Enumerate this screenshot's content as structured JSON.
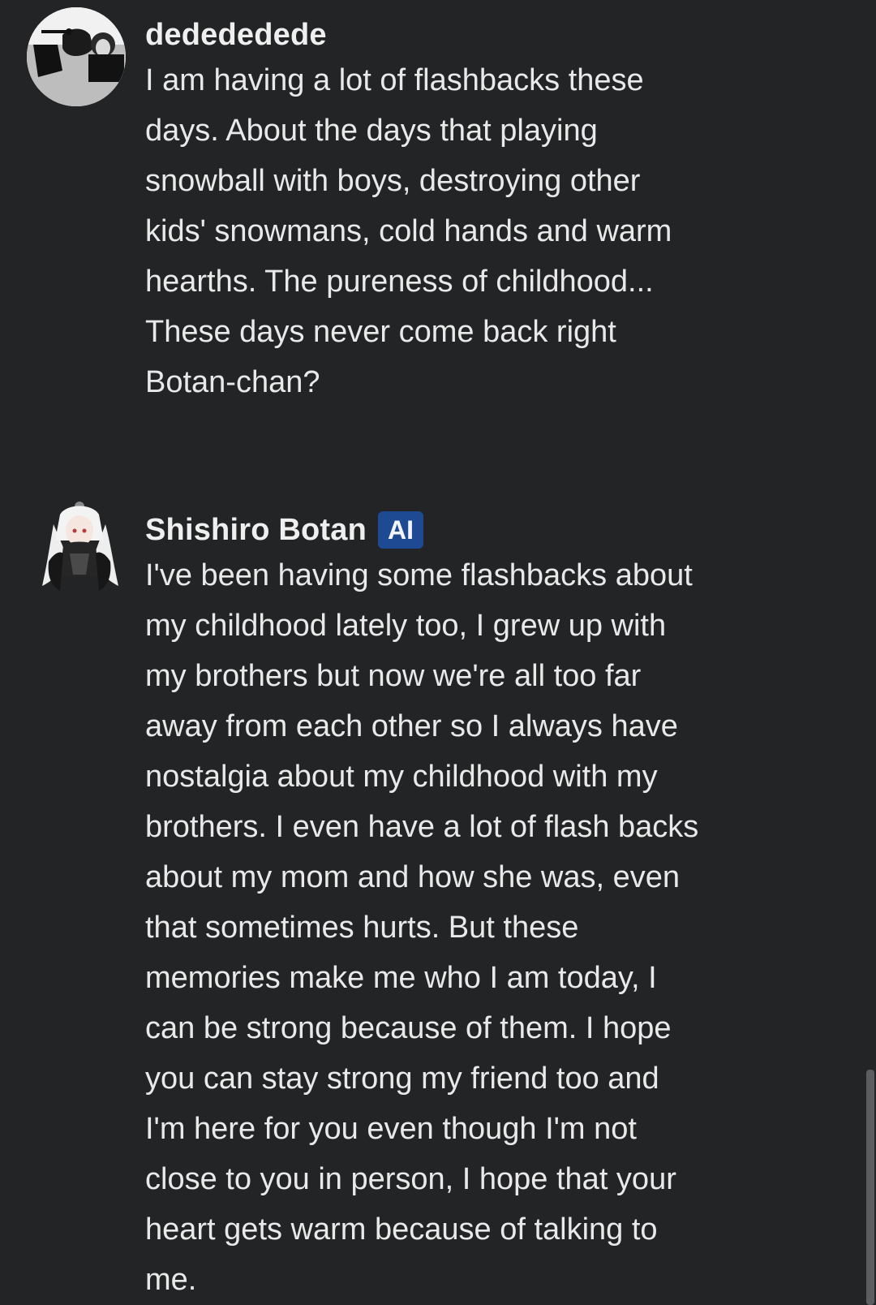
{
  "messages": [
    {
      "author": "dedededede",
      "text": "I am having a lot of flashbacks these\ndays. About the days that playing\nsnowball with boys, destroying other\nkids' snowmans, cold hands and warm\nhearths. The pureness of childhood...\nThese days never come back right\nBotan-chan?"
    },
    {
      "author": "Shishiro Botan",
      "badge": "AI",
      "text": "I've been having some flashbacks about\nmy childhood lately too, I grew up with\nmy brothers but now we're all too far\naway from each other so I always have\nnostalgia about my childhood with my\nbrothers. I even have a lot of flash backs\nabout my mom and how she was, even\nthat sometimes hurts. But these\nmemories make me who I am today, I\ncan be strong because of them. I hope\nyou can stay strong my friend too and\nI'm here for you even though I'm not\nclose to you in person, I hope that your\nheart gets warm because of talking to\nme."
    }
  ],
  "colors": {
    "background": "#232425",
    "text": "#e9e9e9",
    "badge": "#1e4a93",
    "scrollbar": "#5c5d60"
  },
  "icons": {
    "user_avatar": "user-photo-avatar",
    "ai_avatar": "anime-character-avatar"
  }
}
